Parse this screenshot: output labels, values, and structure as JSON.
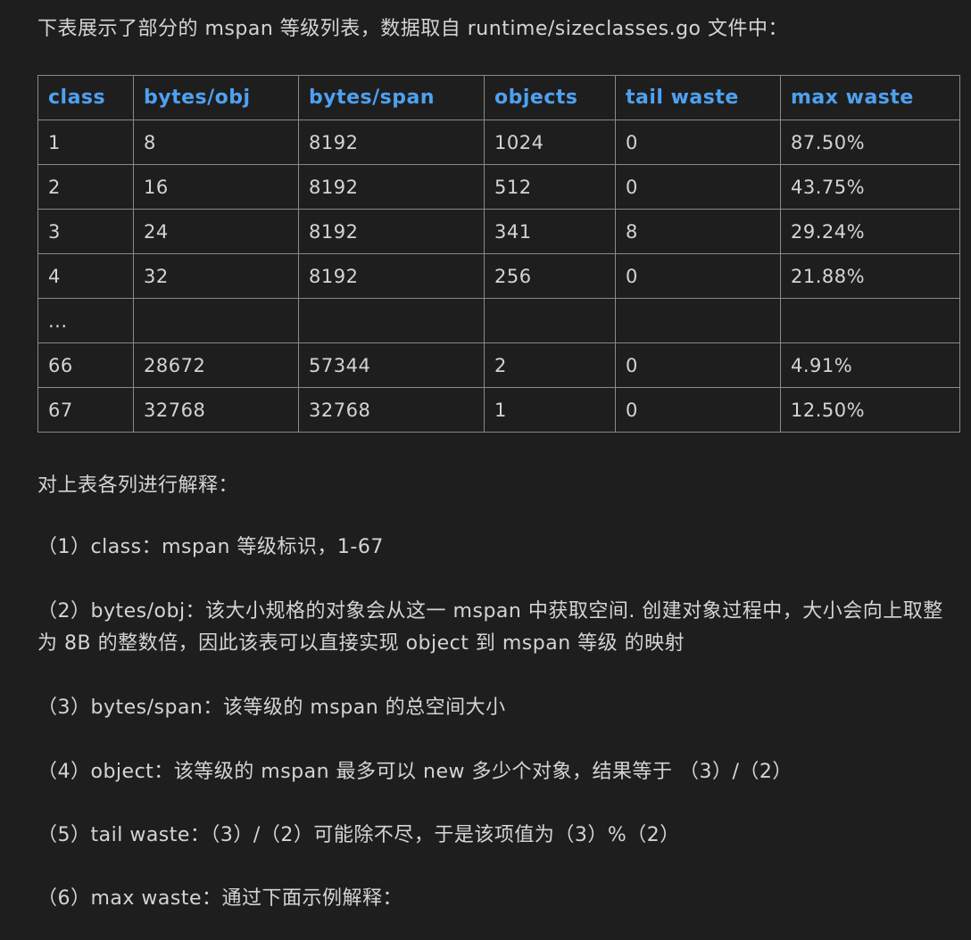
{
  "intro": "下表展示了部分的 mspan 等级列表，数据取自 runtime/sizeclasses.go 文件中：",
  "table": {
    "headers": [
      "class",
      "bytes/obj",
      "bytes/span",
      "objects",
      "tail waste",
      "max waste"
    ],
    "rows": [
      [
        "1",
        "8",
        "8192",
        "1024",
        "0",
        "87.50%"
      ],
      [
        "2",
        "16",
        "8192",
        "512",
        "0",
        "43.75%"
      ],
      [
        "3",
        "24",
        "8192",
        "341",
        "8",
        "29.24%"
      ],
      [
        "4",
        "32",
        "8192",
        "256",
        "0",
        "21.88%"
      ],
      [
        "...",
        "",
        "",
        "",
        "",
        ""
      ],
      [
        "66",
        "28672",
        "57344",
        "2",
        "0",
        "4.91%"
      ],
      [
        "67",
        "32768",
        "32768",
        "1",
        "0",
        "12.50%"
      ]
    ]
  },
  "explain_heading": "对上表各列进行解释：",
  "items": [
    "（1）class：mspan 等级标识，1-67",
    "（2）bytes/obj：该大小规格的对象会从这一 mspan 中获取空间. 创建对象过程中，大小会向上取整为 8B 的整数倍，因此该表可以直接实现 object 到 mspan 等级 的映射",
    "（3）bytes/span：该等级的 mspan 的总空间大小",
    "（4）object：该等级的 mspan 最多可以 new 多少个对象，结果等于 （3）/（2）",
    "（5）tail waste：（3）/（2）可能除不尽，于是该项值为（3）%（2）",
    "（6）max waste：通过下面示例解释："
  ]
}
